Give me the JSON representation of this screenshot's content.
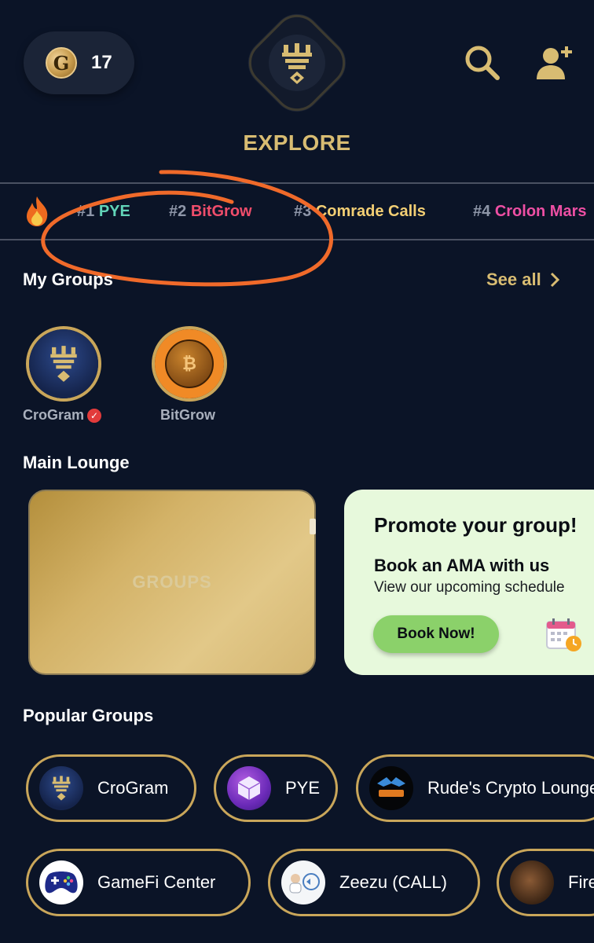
{
  "header": {
    "coin_letter": "G",
    "coin_count": "17",
    "title": "EXPLORE",
    "icons": {
      "search": "search-icon",
      "add_user": "add-user-icon",
      "logo": "crogram-logo"
    }
  },
  "trending": {
    "icon": "fire-icon",
    "items": [
      {
        "rank": "#1",
        "name": "PYE",
        "color": "#62d4b8"
      },
      {
        "rank": "#2",
        "name": "BitGrow",
        "color": "#ef4d6b"
      },
      {
        "rank": "#3",
        "name": "Comrade Calls",
        "color": "#f3cf74"
      },
      {
        "rank": "#4",
        "name": "Crolon Mars",
        "color": "#ee4fa4"
      }
    ]
  },
  "my_groups": {
    "title": "My Groups",
    "see_all": "See all",
    "items": [
      {
        "name": "CroGram",
        "verified": true
      },
      {
        "name": "BitGrow",
        "verified": false
      }
    ]
  },
  "main_lounge": {
    "title": "Main Lounge",
    "card_label": "GROUPS",
    "promo": {
      "title": "Promote your group!",
      "subtitle": "Book an AMA with us",
      "description": "View our upcoming schedule",
      "button": "Book Now!"
    }
  },
  "popular_groups": {
    "title": "Popular Groups",
    "items": [
      {
        "name": "CroGram"
      },
      {
        "name": "PYE"
      },
      {
        "name": "Rude's Crypto Lounge"
      },
      {
        "name": "GameFi Center"
      },
      {
        "name": "Zeezu (CALL)"
      },
      {
        "name": "Fire"
      }
    ]
  },
  "colors": {
    "background": "#0b1427",
    "gold": "#d8bc72",
    "annotation": "#f06a2a"
  }
}
